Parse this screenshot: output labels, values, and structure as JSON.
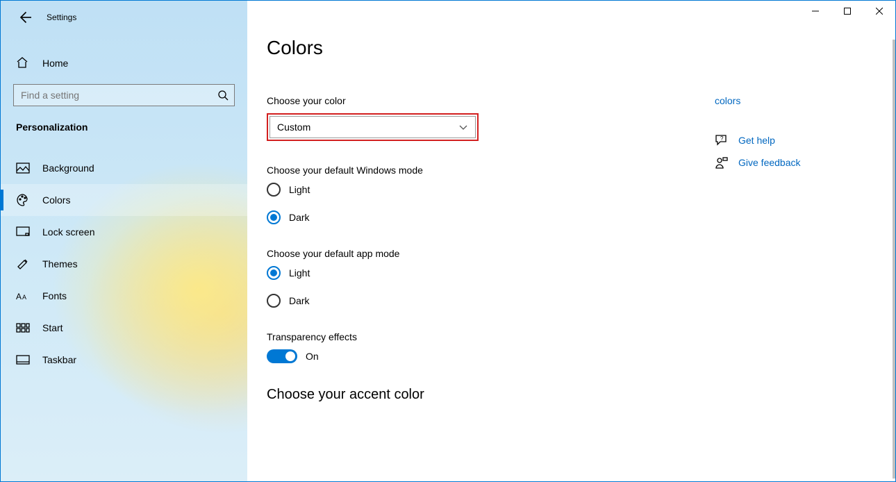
{
  "window": {
    "app_title": "Settings"
  },
  "sidebar": {
    "home_label": "Home",
    "search_placeholder": "Find a setting",
    "section_label": "Personalization",
    "items": [
      {
        "label": "Background"
      },
      {
        "label": "Colors"
      },
      {
        "label": "Lock screen"
      },
      {
        "label": "Themes"
      },
      {
        "label": "Fonts"
      },
      {
        "label": "Start"
      },
      {
        "label": "Taskbar"
      }
    ]
  },
  "page": {
    "title": "Colors",
    "choose_color": {
      "label": "Choose your color",
      "value": "Custom"
    },
    "windows_mode": {
      "label": "Choose your default Windows mode",
      "option_light": "Light",
      "option_dark": "Dark",
      "selected": "Dark"
    },
    "app_mode": {
      "label": "Choose your default app mode",
      "option_light": "Light",
      "option_dark": "Dark",
      "selected": "Light"
    },
    "transparency": {
      "label": "Transparency effects",
      "state_label": "On"
    },
    "accent_heading": "Choose your accent color"
  },
  "help": {
    "partial_link": "colors",
    "get_help": "Get help",
    "give_feedback": "Give feedback"
  }
}
